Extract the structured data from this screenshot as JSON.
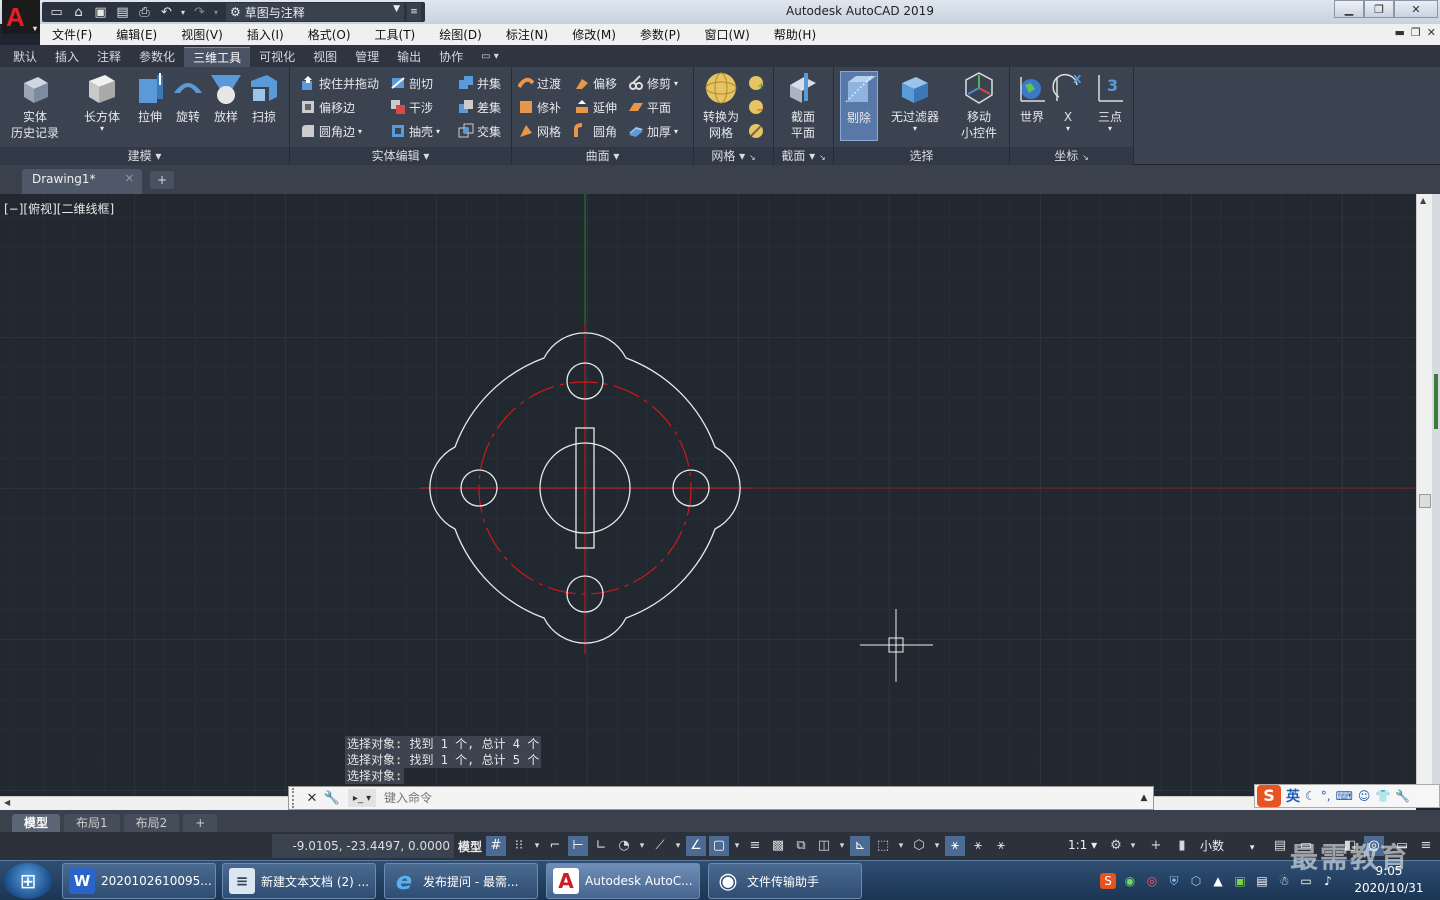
{
  "app": {
    "window_title": "Autodesk AutoCAD 2019",
    "logo_letter": "A",
    "workspace": "草图与注释"
  },
  "menu": [
    "文件(F)",
    "编辑(E)",
    "视图(V)",
    "插入(I)",
    "格式(O)",
    "工具(T)",
    "绘图(D)",
    "标注(N)",
    "修改(M)",
    "参数(P)",
    "窗口(W)",
    "帮助(H)"
  ],
  "ribbon_tabs": [
    {
      "label": "默认",
      "active": false
    },
    {
      "label": "插入",
      "active": false
    },
    {
      "label": "注释",
      "active": false
    },
    {
      "label": "参数化",
      "active": false
    },
    {
      "label": "三维工具",
      "active": true
    },
    {
      "label": "可视化",
      "active": false
    },
    {
      "label": "视图",
      "active": false
    },
    {
      "label": "管理",
      "active": false
    },
    {
      "label": "输出",
      "active": false
    },
    {
      "label": "协作",
      "active": false
    }
  ],
  "panels": {
    "modeling": {
      "title": "建模",
      "history_line1": "实体",
      "history_line2": "历史记录",
      "box": "长方体",
      "extrude": "拉伸",
      "revolve": "旋转",
      "loft": "放样",
      "sweep": "扫掠"
    },
    "solid_edit": {
      "title": "实体编辑",
      "press_pull": "按住并拖动",
      "offset_edge": "偏移边",
      "fillet_edge": "圆角边",
      "slice": "剖切",
      "interfere": "干涉",
      "shell": "抽壳",
      "union": "并集",
      "subtract": "差集",
      "intersect": "交集"
    },
    "surface": {
      "title": "曲面",
      "blend": "过渡",
      "patch": "修补",
      "network": "网格",
      "offset": "偏移",
      "extend": "延伸",
      "fillet": "圆角",
      "trim": "修剪",
      "planar": "平面",
      "thicken": "加厚"
    },
    "mesh": {
      "title": "网格",
      "convert_line1": "转换为",
      "convert_line2": "网格"
    },
    "section": {
      "title": "截面",
      "plane_line1": "截面",
      "plane_line2": "平面"
    },
    "selection": {
      "title": "选择",
      "cull": "剔除",
      "no_filter": "无过滤器",
      "gizmo_line1": "移动",
      "gizmo_line2": "小控件"
    },
    "ucs": {
      "title": "坐标",
      "world": "世界",
      "x": "X",
      "three_point": "三点",
      "three_point_badge": "3"
    }
  },
  "document": {
    "tab": "Drawing1*",
    "viewport_label": "[−][俯视][二维线框]"
  },
  "command": {
    "history": [
      "选择对象: 找到 1 个, 总计 4 个",
      "选择对象: 找到 1 个, 总计 5 个",
      "选择对象:"
    ],
    "placeholder": "键入命令"
  },
  "layout_tabs": [
    {
      "label": "模型",
      "active": true
    },
    {
      "label": "布局1",
      "active": false
    },
    {
      "label": "布局2",
      "active": false
    }
  ],
  "status": {
    "coords": "-9.0105, -23.4497, 0.0000",
    "model": "模型",
    "scale": "1:1",
    "units": "小数"
  },
  "ime": {
    "logo": "S",
    "lang": "英"
  },
  "taskbar": [
    {
      "label": "2020102610095...",
      "icon": "W",
      "color": "#2b64c8"
    },
    {
      "label": "新建文本文档 (2) ...",
      "icon": "≡",
      "color": "#7aa8d8"
    },
    {
      "label": "发布提问 - 最需...",
      "icon": "e",
      "color": "#2a8ad8"
    },
    {
      "label": "Autodesk AutoC...",
      "icon": "A",
      "color": "#c81e24"
    },
    {
      "label": "文件传输助手",
      "icon": "◉",
      "color": "#2dbb4e"
    }
  ],
  "clock": {
    "time": "9:05",
    "date": "2020/10/31"
  },
  "watermark": "最需教育",
  "drawing_colors": {
    "geometry": "#e8e8e8",
    "centerline": "#d01818",
    "ucs_y": "#1f8a1f"
  }
}
